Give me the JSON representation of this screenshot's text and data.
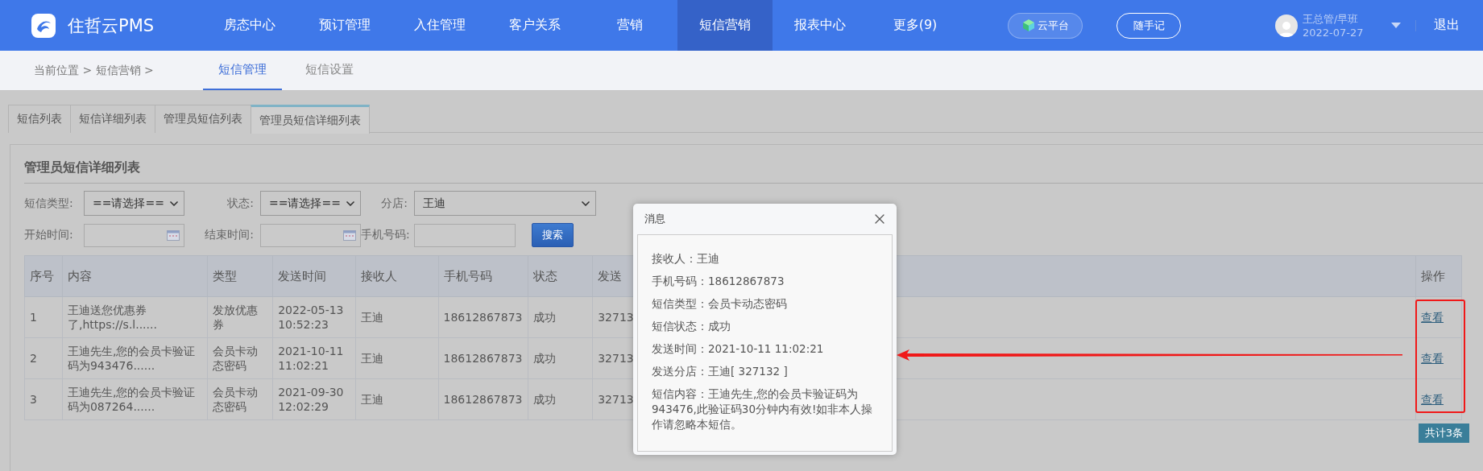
{
  "app": {
    "logo_text": "住哲云PMS"
  },
  "nav": [
    {
      "label": "房态中心",
      "selected": false
    },
    {
      "label": "预订管理",
      "selected": false
    },
    {
      "label": "入住管理",
      "selected": false
    },
    {
      "label": "客户关系",
      "selected": false
    },
    {
      "label": "营销",
      "selected": false
    },
    {
      "label": "短信营销",
      "selected": true
    },
    {
      "label": "报表中心",
      "selected": false
    },
    {
      "label": "更多(9)",
      "selected": false
    }
  ],
  "cloud_button": "云平台",
  "notes_button": "随手记",
  "user": {
    "name": "王总管/早班",
    "date": "2022-07-27"
  },
  "logout": "退出",
  "breadcrumb": "当前位置 > 短信营销 >",
  "sub_tabs": [
    {
      "label": "短信管理",
      "selected": true
    },
    {
      "label": "短信设置",
      "selected": false
    }
  ],
  "list_tabs": [
    {
      "label": "短信列表",
      "selected": false
    },
    {
      "label": "短信详细列表",
      "selected": false
    },
    {
      "label": "管理员短信列表",
      "selected": false
    },
    {
      "label": "管理员短信详细列表",
      "selected": true
    }
  ],
  "panel": {
    "title": "管理员短信详细列表",
    "filters": [
      {
        "kind": "select",
        "label": "短信类型:",
        "value": "==请选择=="
      },
      {
        "kind": "select",
        "label": "状态:",
        "value": "==请选择=="
      },
      {
        "kind": "select",
        "label": "分店:",
        "value": "王迪"
      },
      {
        "kind": "date",
        "label": "开始时间:"
      },
      {
        "kind": "date",
        "label": "结束时间:"
      },
      {
        "kind": "text",
        "label": "手机号码:"
      }
    ],
    "search_button": "搜索"
  },
  "table": {
    "columns": [
      "序号",
      "内容",
      "类型",
      "发送时间",
      "接收人",
      "手机号码",
      "状态",
      "发送"
    ],
    "action_column": "操作",
    "rows": [
      {
        "cells": [
          "1",
          "王迪送您优惠券了,https://s.l......",
          "发放优惠券",
          "2022-05-13 10:52:23",
          "王迪",
          "18612867873",
          "成功",
          "32713"
        ],
        "action": "查看"
      },
      {
        "cells": [
          "2",
          "王迪先生,您的会员卡验证码为943476......",
          "会员卡动态密码",
          "2021-10-11 11:02:21",
          "王迪",
          "18612867873",
          "成功",
          "32713"
        ],
        "action": "查看"
      },
      {
        "cells": [
          "3",
          "王迪先生,您的会员卡验证码为087264......",
          "会员卡动态密码",
          "2021-09-30 12:02:29",
          "王迪",
          "18612867873",
          "成功",
          "32713"
        ],
        "action": "查看"
      }
    ]
  },
  "total": "共计3条",
  "dialog": {
    "title": "消息",
    "fields": [
      {
        "label": "接收人：",
        "value": "王迪"
      },
      {
        "label": "手机号码：",
        "value": "18612867873"
      },
      {
        "label": "短信类型：",
        "value": "会员卡动态密码"
      },
      {
        "label": "短信状态：",
        "value": "成功"
      },
      {
        "label": "发送时间：",
        "value": "2021-10-11 11:02:21"
      },
      {
        "label": "发送分店：",
        "value": "王迪[ 327132 ]"
      },
      {
        "label": "短信内容：",
        "value": "王迪先生,您的会员卡验证码为943476,此验证码30分钟内有效!如非本人操作请忽略本短信。"
      }
    ]
  }
}
